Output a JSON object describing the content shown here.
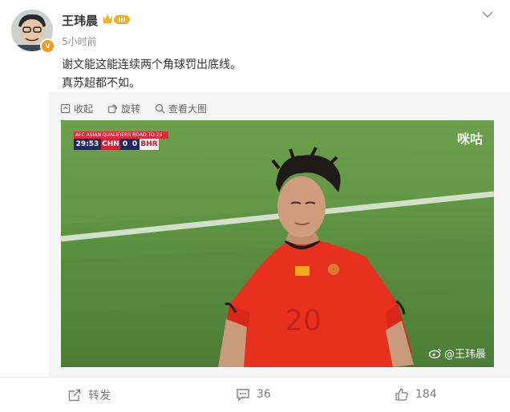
{
  "post": {
    "author": "王玮晨",
    "avatar_badge": "v",
    "timestamp": "5小时前",
    "text_lines": [
      "谢文能这能连续两个角球罚出底线。",
      "真苏超都不如。"
    ]
  },
  "media_toolbar": {
    "collect": "收起",
    "rotate": "旋转",
    "view_large": "查看大图"
  },
  "photo": {
    "scoreboard": {
      "competition": "AFC ASIAN QUALIFIERS  ROAD TO 26",
      "clock": "29:53",
      "team_a": "CHN",
      "score_a": "0",
      "score_b": "0",
      "team_b": "BHR"
    },
    "watermark_migu": "咪咕",
    "watermark_weibo": "@王玮晨",
    "jersey_number": "20"
  },
  "actions": {
    "repost": "转发",
    "comments": "36",
    "likes": "184"
  },
  "colors": {
    "text": "#333333",
    "muted": "#939393",
    "accent_orange": "#f39b1b",
    "jersey_red": "#e8301f",
    "pitch_green": "#4f8a3a"
  }
}
